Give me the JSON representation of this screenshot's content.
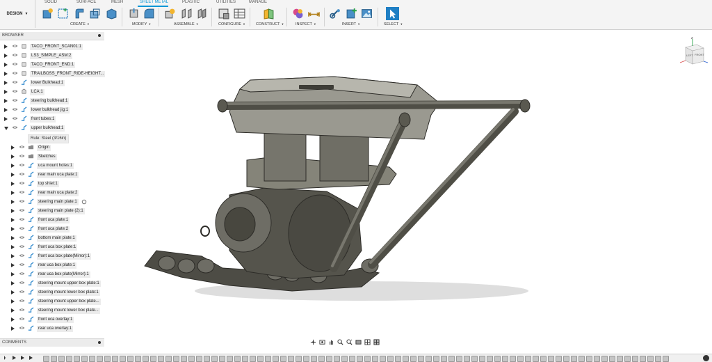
{
  "workspace": {
    "label": "DESIGN"
  },
  "tabs": [
    {
      "label": "SOLID",
      "active": false
    },
    {
      "label": "SURFACE",
      "active": false
    },
    {
      "label": "MESH",
      "active": false
    },
    {
      "label": "SHEET METAL",
      "active": true
    },
    {
      "label": "PLASTIC",
      "active": false
    },
    {
      "label": "UTILITIES",
      "active": false
    },
    {
      "label": "MANAGE",
      "active": false
    }
  ],
  "groups": [
    {
      "label": "CREATE"
    },
    {
      "label": "MODIFY"
    },
    {
      "label": "ASSEMBLE"
    },
    {
      "label": "CONFIGURE"
    },
    {
      "label": "CONSTRUCT"
    },
    {
      "label": "INSPECT"
    },
    {
      "label": "INSERT"
    },
    {
      "label": "SELECT"
    }
  ],
  "browser": {
    "title": "BROWSER",
    "items": [
      {
        "label": "TACO_FRONT_SCAN01:1"
      },
      {
        "label": "LS3_SIMPLE_ASM:2"
      },
      {
        "label": "TACO_FRONT_END:1"
      },
      {
        "label": "TRAILBOSS_FRONT_RIDE-HEIGHT..."
      },
      {
        "label": "lower Bulkhead:1"
      },
      {
        "label": "LCA:1"
      },
      {
        "label": "steering bulkhead:1"
      },
      {
        "label": "lower bulkhead jig:1"
      },
      {
        "label": "front tubes:1"
      },
      {
        "label": "upper bulkhead:1"
      }
    ],
    "rule": "Rule: Steel (3/16in)",
    "children": [
      {
        "label": "Origin"
      },
      {
        "label": "Sketches"
      },
      {
        "label": "uca mount holes:1"
      },
      {
        "label": "rear main uca plate:1"
      },
      {
        "label": "top shiet:1"
      },
      {
        "label": "rear main uca plate:2"
      },
      {
        "label": "steering main plate:1"
      },
      {
        "label": "steering main plate (2):1"
      },
      {
        "label": "front uca plate:1"
      },
      {
        "label": "front uca plate:2"
      },
      {
        "label": "bottom main plate:1"
      },
      {
        "label": "front uca box plate:1"
      },
      {
        "label": "front uca box plate(Mirror):1"
      },
      {
        "label": "rear uca box plate:1"
      },
      {
        "label": "rear uca box plate(Mirror):1"
      },
      {
        "label": "steering mount upper box plate:1"
      },
      {
        "label": "steering mount lower box plate:1"
      },
      {
        "label": "steering mount upper box plate..."
      },
      {
        "label": "steering mount lower box plate..."
      },
      {
        "label": "front uca overlay:1"
      },
      {
        "label": "rear uca overlay:1"
      }
    ]
  },
  "comments": {
    "title": "COMMENTS"
  },
  "viewcube": {
    "left": "LEFT",
    "front": "FRONT",
    "z": "Z"
  },
  "colors": {
    "accent": "#0696d7",
    "model": "#6b6a62"
  }
}
